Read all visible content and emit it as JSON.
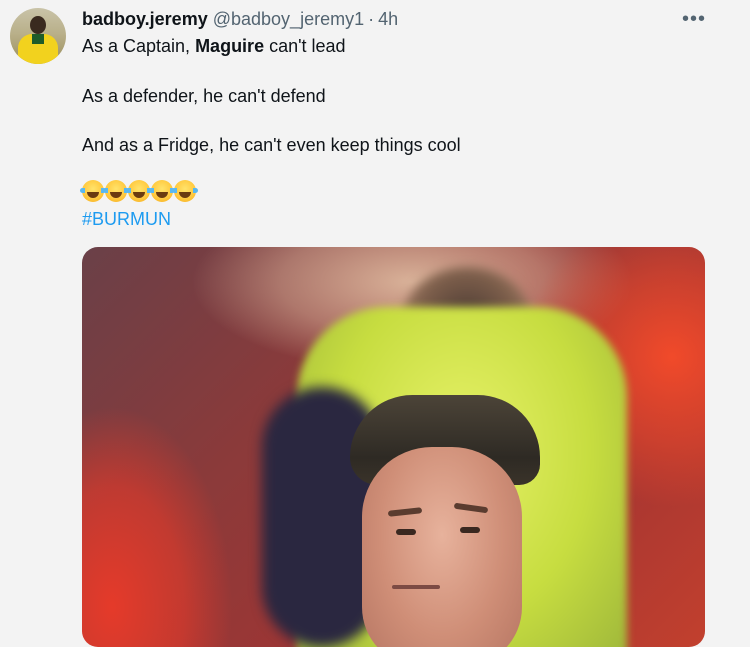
{
  "tweet": {
    "display_name": "badboy.jeremy",
    "handle": "@badboy_jeremy1",
    "separator": "·",
    "time": "4h",
    "more_label": "•••",
    "line1_pre": "As a Captain, ",
    "line1_bold": "Maguire",
    "line1_post": " can't lead",
    "line2": "As a defender, he can't defend",
    "line3": "And as a Fridge, he can't even keep things cool",
    "emoji_count": 5,
    "emoji_name": "face-with-tears-of-joy",
    "hashtag": "#BURMUN"
  },
  "colors": {
    "background": "#f3f3f3",
    "text": "#0f1419",
    "muted": "#536471",
    "link": "#1d9bf0"
  }
}
